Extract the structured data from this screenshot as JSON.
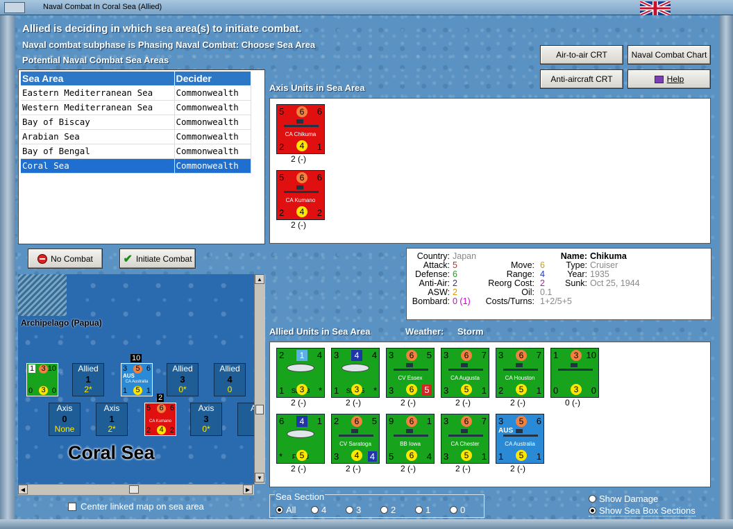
{
  "window": {
    "title": "Naval Combat In Coral Sea (Allied)"
  },
  "header": {
    "status": "Allied is deciding in which sea area(s) to initiate combat.",
    "subphase": "Naval combat subphase is Phasing Naval Combat: Choose Sea Area",
    "potential": "Potential Naval Combat Sea Areas"
  },
  "buttons": {
    "air_to_air": "Air-to-air CRT",
    "naval_chart": "Naval Combat Chart",
    "anti_aircraft": "Anti-aircraft CRT",
    "help": "Help",
    "no_combat": "No Combat",
    "initiate": "Initiate Combat"
  },
  "sea_table": {
    "col_area": "Sea Area",
    "col_decider": "Decider",
    "rows": [
      {
        "area": "Eastern Mediterranean Sea",
        "decider": "Commonwealth"
      },
      {
        "area": "Western Mediterranean Sea",
        "decider": "Commonwealth"
      },
      {
        "area": "Bay of Biscay",
        "decider": "Commonwealth"
      },
      {
        "area": "Arabian Sea",
        "decider": "Commonwealth"
      },
      {
        "area": "Bay of Bengal",
        "decider": "Commonwealth"
      },
      {
        "area": "Coral Sea",
        "decider": "Commonwealth",
        "selected": true
      }
    ]
  },
  "map": {
    "region_label": "Archipelago (Papua)",
    "sea_label": "Coral Sea",
    "allied_boxes": [
      {
        "side": "Allied",
        "num": "1",
        "val": "2*"
      },
      {
        "side": "Allied",
        "num": "3",
        "val": "0*"
      },
      {
        "side": "Allied",
        "num": "4",
        "val": "0"
      }
    ],
    "axis_boxes": [
      {
        "side": "Axis",
        "num": "0",
        "val": "None"
      },
      {
        "side": "Axis",
        "num": "1",
        "val": "2*"
      },
      {
        "side": "Axis",
        "num": "3",
        "val": "0*"
      },
      {
        "side": "A"
      }
    ],
    "stack_counts": {
      "allied": "10",
      "axis": "2"
    },
    "mini_allied": {
      "tl": "1",
      "tc": "3",
      "tr": "10",
      "bl": "0",
      "bc": "3",
      "br": "0"
    },
    "mini_aus": {
      "nation": "AUS",
      "tl": "3",
      "tc": "5",
      "tr": "6",
      "bl": "1",
      "bc": "5",
      "br": "1",
      "name": "CA Australia"
    },
    "mini_axis": {
      "tl": "5",
      "tc": "6",
      "tr": "6",
      "bl": "2",
      "bc": "4",
      "br": "2",
      "name": "CA Kumano"
    },
    "center_label": "Center linked map on sea area"
  },
  "axis_units": {
    "heading": "Axis Units in Sea Area",
    "units": [
      {
        "name": "CA Chikuma",
        "tl": "5",
        "tc": "6",
        "tr": "6",
        "bl": "2",
        "bc": "4",
        "br": "1",
        "status": "2 (-)"
      },
      {
        "name": "CA Kumano",
        "tl": "5",
        "tc": "6",
        "tr": "6",
        "bl": "2",
        "bc": "4",
        "br": "2",
        "status": "2 (-)"
      }
    ]
  },
  "info": {
    "country_l": "Country:",
    "country": "Japan",
    "attack_l": "Attack:",
    "attack": "5",
    "defense_l": "Defense:",
    "defense": "6",
    "antiair_l": "Anti-Air:",
    "antiair": "2",
    "asw_l": "ASW:",
    "asw": "2",
    "bombard_l": "Bombard:",
    "bombard": "0 (1)",
    "move_l": "Move:",
    "move": "6",
    "range_l": "Range:",
    "range": "4",
    "reorg_l": "Reorg Cost:",
    "reorg": "2",
    "oil_l": "Oil:",
    "oil": "0.1",
    "costs_l": "Costs/Turns:",
    "costs": "1+2/5+5",
    "name_l": "Name:",
    "name": "Chikuma",
    "type_l": "Type:",
    "type": "Cruiser",
    "year_l": "Year:",
    "year": "1935",
    "sunk_l": "Sunk:",
    "sunk": "Oct 25, 1944"
  },
  "allied_units": {
    "heading": "Allied Units in Sea Area",
    "weather_label": "Weather:",
    "weather": "Storm",
    "units": [
      {
        "name": "SBD-3",
        "kind": "air",
        "tl": "2",
        "tc": "1",
        "tr": "4",
        "bl": "1",
        "bc": "3",
        "br": "*",
        "status": "2 (-)",
        "color": "green"
      },
      {
        "name": "SBD-5",
        "kind": "air",
        "tl": "3",
        "tc": "4",
        "tr": "4",
        "bl": "1",
        "bc": "3",
        "br": "*",
        "status": "2 (-)",
        "color": "green"
      },
      {
        "name": "CV Essex",
        "kind": "ship",
        "tl": "3",
        "tc": "6",
        "tr": "5",
        "bl": "3",
        "bc": "6",
        "br": "5",
        "status": "2 (-)",
        "color": "green"
      },
      {
        "name": "CA Augusta",
        "kind": "ship",
        "tl": "3",
        "tc": "6",
        "tr": "7",
        "bl": "3",
        "bc": "5",
        "br": "1",
        "status": "2 (-)",
        "color": "green"
      },
      {
        "name": "CA Houston",
        "kind": "ship",
        "tl": "3",
        "tc": "6",
        "tr": "7",
        "bl": "2",
        "bc": "5",
        "br": "1",
        "status": "2 (-)",
        "color": "green"
      },
      {
        "name": "",
        "kind": "ship",
        "tl": "1",
        "tc": "3",
        "tr": "10",
        "bl": "0",
        "bc": "3",
        "br": "0",
        "status": "0 (-)",
        "color": "green"
      },
      {
        "name": "F6F-3",
        "kind": "air",
        "tl": "6",
        "tc": "4",
        "tr": "1",
        "bl": "*",
        "bc": "5",
        "br": "",
        "status": "2 (-)",
        "color": "green"
      },
      {
        "name": "CV Saratoga",
        "kind": "ship",
        "tl": "2",
        "tc": "6",
        "tr": "5",
        "bl": "3",
        "bc": "4",
        "br": "4",
        "status": "2 (-)",
        "color": "green"
      },
      {
        "name": "BB Iowa",
        "kind": "ship",
        "tl": "9",
        "tc": "6",
        "tr": "1",
        "bl": "5",
        "bc": "6",
        "br": "4",
        "status": "2 (-)",
        "color": "green"
      },
      {
        "name": "CA Chester",
        "kind": "ship",
        "tl": "3",
        "tc": "6",
        "tr": "7",
        "bl": "3",
        "bc": "5",
        "br": "1",
        "status": "2 (-)",
        "color": "green"
      },
      {
        "name": "CA Australia",
        "kind": "ship",
        "nation": "AUS",
        "tl": "3",
        "tc": "5",
        "tr": "6",
        "bl": "1",
        "bc": "5",
        "br": "1",
        "status": "2 (-)",
        "color": "blue"
      }
    ]
  },
  "sea_section": {
    "title": "Sea Section",
    "options": [
      "All",
      "4",
      "3",
      "2",
      "1",
      "0"
    ],
    "selected": "All"
  },
  "toggles": {
    "show_damage": "Show Damage",
    "show_boxes": "Show Sea Box Sections"
  }
}
